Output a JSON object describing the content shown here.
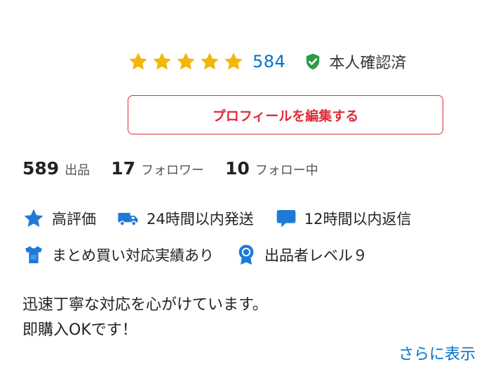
{
  "rating": {
    "stars_filled": 5,
    "stars_total": 5,
    "review_count": "584",
    "star_color": "#f5b50a"
  },
  "verification": {
    "label": "本人確認済",
    "icon": "shield-check-icon",
    "color": "#2e9b45"
  },
  "actions": {
    "edit_profile_label": "プロフィールを編集する",
    "accent_color": "#e02b3a"
  },
  "stats": [
    {
      "value": "589",
      "label": "出品"
    },
    {
      "value": "17",
      "label": "フォロワー"
    },
    {
      "value": "10",
      "label": "フォロー中"
    }
  ],
  "badges": [
    {
      "icon": "star-icon",
      "label": "高評価"
    },
    {
      "icon": "truck-icon",
      "label": "24時間以内発送"
    },
    {
      "icon": "chat-bubble-icon",
      "label": "12時間以内返信"
    },
    {
      "icon": "shirt-icon",
      "label": "まとめ買い対応実績あり"
    },
    {
      "icon": "medal-icon",
      "label": "出品者レベル９"
    }
  ],
  "badge_icon_color": "#1f7ad6",
  "bio": {
    "lines": [
      "迅速丁寧な対応を心がけています。",
      "即購入OKです！"
    ]
  },
  "show_more_label": "さらに表示",
  "link_color": "#0073cc"
}
